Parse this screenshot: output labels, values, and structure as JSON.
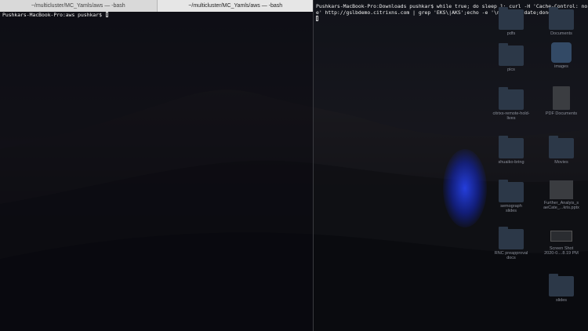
{
  "tabs": [
    {
      "label": "~/multicluster/MC_Yamls/aws — -bash"
    },
    {
      "label": "~/multicluster/MC_Yamls/aws — -bash"
    }
  ],
  "left_terminal": {
    "prompt": "Pushkars-MacBook-Pro:aws pushkar$"
  },
  "right_terminal": {
    "line1": "Pushkars-MacBook-Pro:Downloads pushkar$ while true; do sleep 1; curl -H 'Cache-Control: no-cach",
    "line2": "e' http://gslbdemo.citrixns.com | grep 'EKS\\|AKS';echo -e '\\n\\n\\n\\n';date;done"
  },
  "desktop": {
    "items": [
      {
        "label": "pdfs",
        "icon": "folder-icon"
      },
      {
        "label": "Documents",
        "icon": "folder-icon"
      },
      {
        "label": "pics",
        "icon": "folder-icon"
      },
      {
        "label": "images",
        "icon": "app-icon"
      },
      {
        "label": "citrixs-remote-hold-\nlives",
        "icon": "folder-icon"
      },
      {
        "label": "PDF Documents",
        "icon": "document-icon"
      },
      {
        "label": "shuaiko-bring",
        "icon": "folder-icon"
      },
      {
        "label": "Movies",
        "icon": "folder-icon"
      },
      {
        "label": "semograph\nslides",
        "icon": "folder-icon"
      },
      {
        "label": "Further_Analyis_s\naeCate_...kris.pptx",
        "icon": "presentation-icon"
      },
      {
        "label": "RNC preapproval\ndocs",
        "icon": "folder-icon"
      },
      {
        "label": "Screen Shot\n2020-0....8.19 PM",
        "icon": "screenshot-icon"
      },
      {
        "label": "slides",
        "icon": "folder-icon"
      }
    ]
  },
  "colors": {
    "tab_bg": "#d9d9d9",
    "terminal_text": "#f0f0f0",
    "glow": "#2846ff"
  }
}
